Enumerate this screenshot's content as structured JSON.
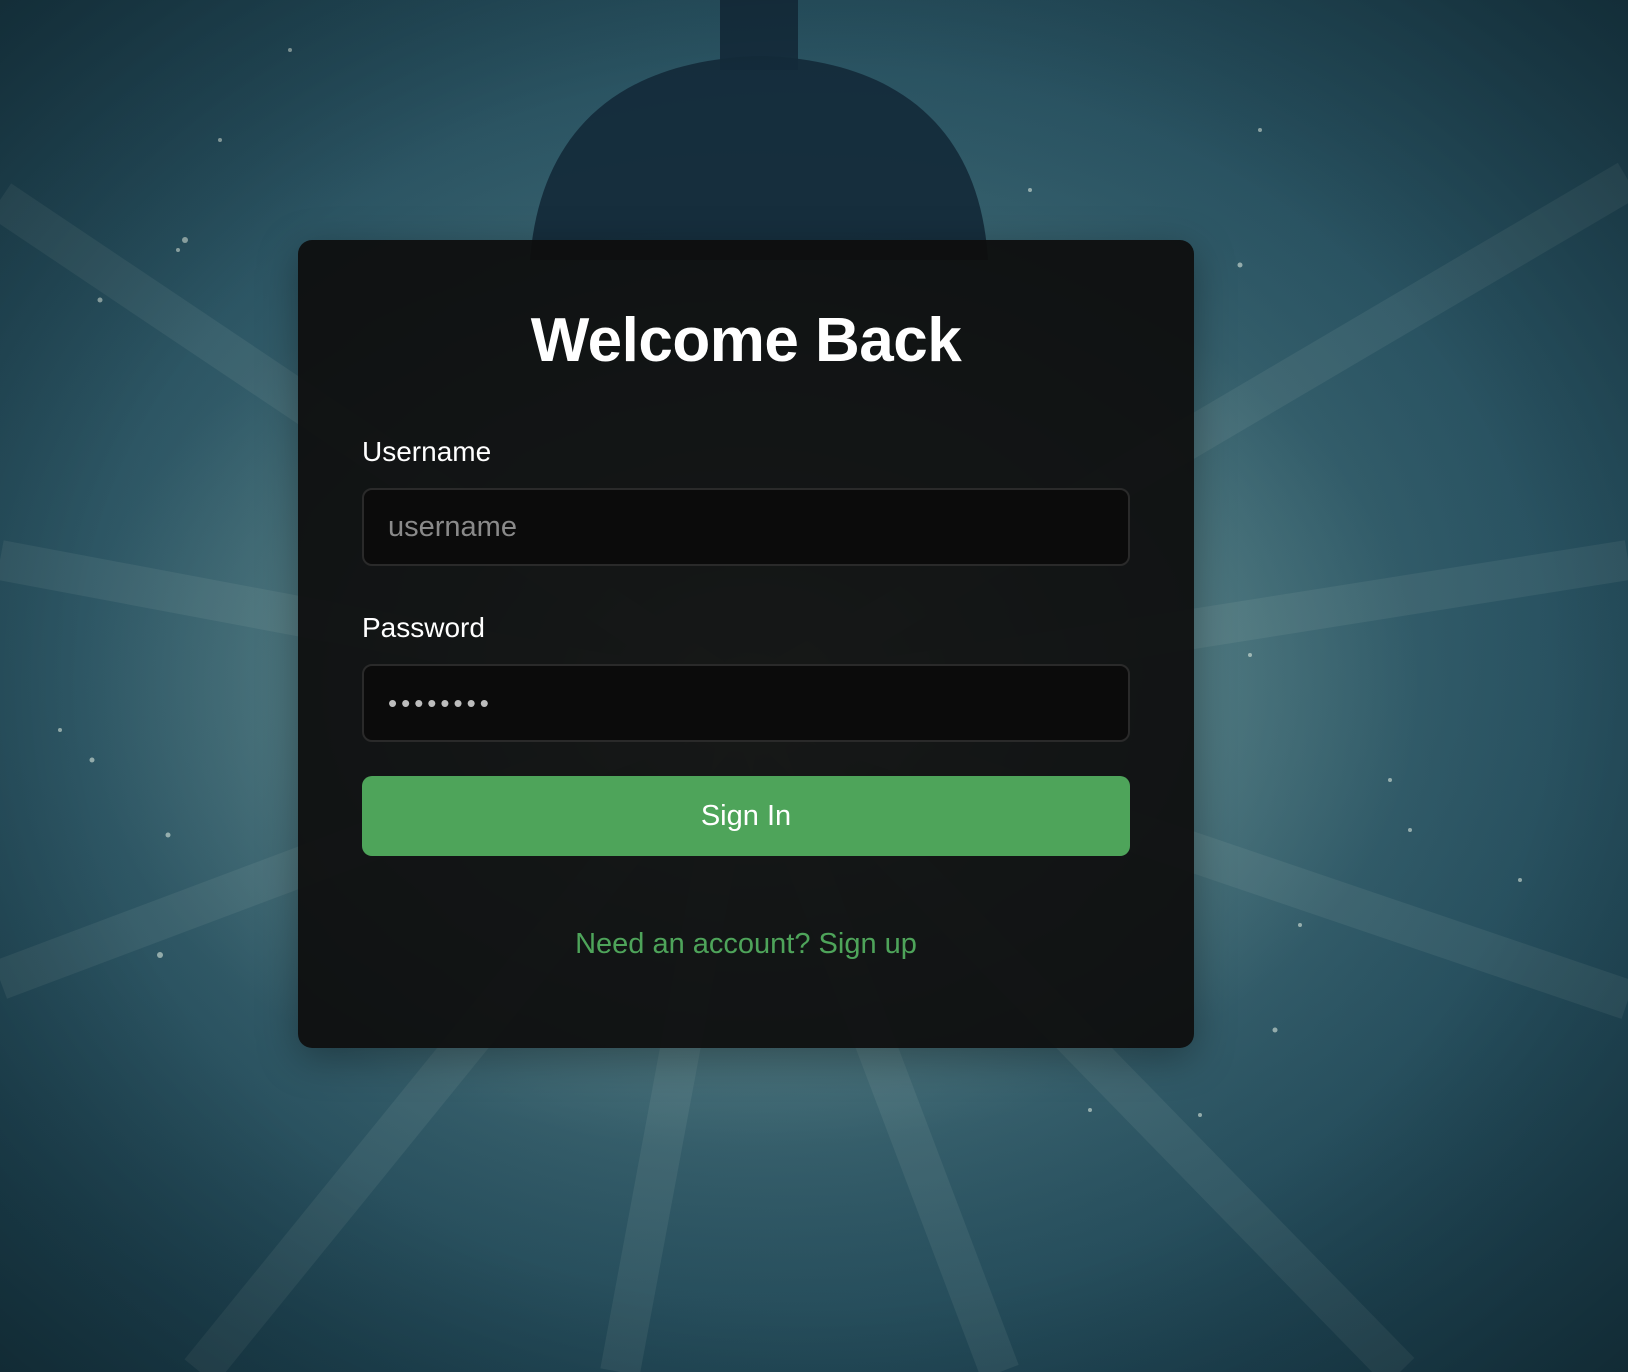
{
  "login": {
    "title": "Welcome Back",
    "username_label": "Username",
    "username_placeholder": "username",
    "password_label": "Password",
    "password_value": "••••••••",
    "submit_label": "Sign In",
    "signup_link": "Need an account? Sign up"
  },
  "colors": {
    "accent": "#4ea45a",
    "card_bg": "#0e0e0e",
    "text": "#ffffff"
  },
  "background": {
    "icon": "underwater-ocean-photo"
  }
}
